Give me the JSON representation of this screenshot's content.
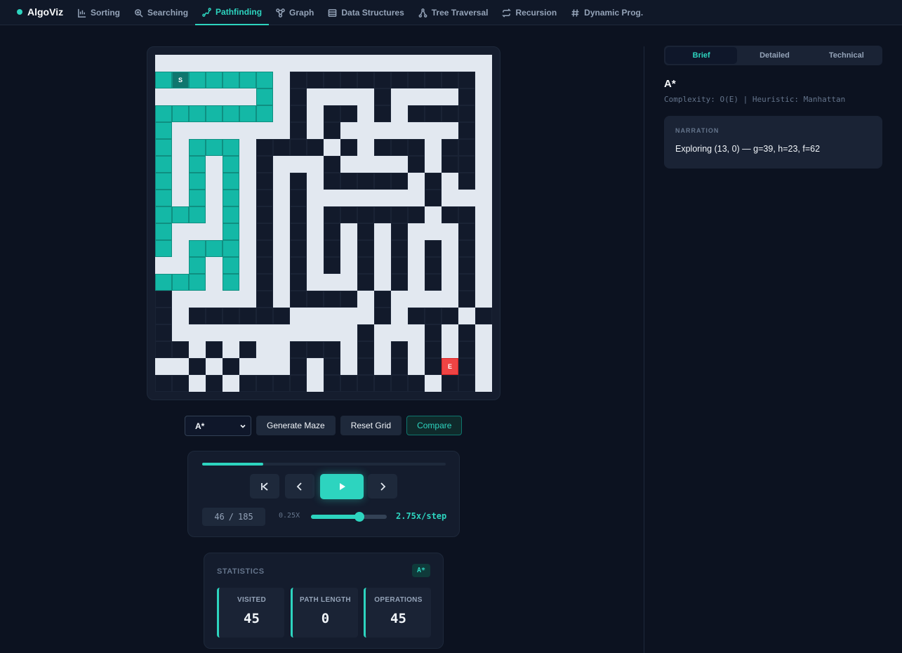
{
  "app": {
    "name": "AlgoViz"
  },
  "nav": [
    {
      "label": "Sorting",
      "icon": "sort-icon",
      "active": false
    },
    {
      "label": "Searching",
      "icon": "search-icon",
      "active": false
    },
    {
      "label": "Pathfinding",
      "icon": "route-icon",
      "active": true
    },
    {
      "label": "Graph",
      "icon": "graph-icon",
      "active": false
    },
    {
      "label": "Data Structures",
      "icon": "table-icon",
      "active": false
    },
    {
      "label": "Tree Traversal",
      "icon": "tree-icon",
      "active": false
    },
    {
      "label": "Recursion",
      "icon": "repeat-icon",
      "active": false
    },
    {
      "label": "Dynamic Prog.",
      "icon": "hash-icon",
      "active": false
    }
  ],
  "maze": {
    "legend": {
      "w": "wall",
      "o": "open",
      "v": "visited",
      "S": "start",
      "E": "end"
    },
    "rows": [
      "wwwwwwwwwwwwwwwwwwww",
      "vSvvvvvwooooooooooow",
      "wwwwwwvwowwwwowwwwow",
      "vvvvvvvwowoowowoooow",
      "vwwwwwwwowowwwwwwwow",
      "vwvvvwoooowowooowoow",
      "vwvwvwowwwowwwwowoow",
      "vwvwvwowowooooowowow",
      "vwvwvwowowwwwwwwowww",
      "vvvwvwowowoooooowoow",
      "vwwwvwowowowowowwwow",
      "vwvvvwowowowowowowow",
      "wwvwvwowowowowowowow",
      "vvvwvwowowwwowowowow",
      "owwwwwowoooowowwwwow",
      "owoooooowwwwwowooowow",
      "owwwwwwwwwwwowwwowow",
      "oowowowwooowowowowow",
      "wwowowwwowowowowoEow",
      "oowowoooowoooooowoow"
    ],
    "start_label": "S",
    "end_label": "E"
  },
  "controls": {
    "algorithm": "A*",
    "generate_label": "Generate Maze",
    "reset_label": "Reset Grid",
    "compare_label": "Compare"
  },
  "player": {
    "current_step": "46",
    "separator": "/",
    "total_steps": "185",
    "progress_fraction": 0.25,
    "speed_min": "0.25X",
    "speed_fraction": 0.64,
    "speed_value": "2.75x/step"
  },
  "stats": {
    "title": "STATISTICS",
    "badge": "A*",
    "items": [
      {
        "label": "VISITED",
        "value": "45"
      },
      {
        "label": "PATH LENGTH",
        "value": "0"
      },
      {
        "label": "OPERATIONS",
        "value": "45"
      }
    ]
  },
  "side": {
    "tabs": [
      "Brief",
      "Detailed",
      "Technical"
    ],
    "active_tab": 0,
    "algo_name": "A*",
    "meta": "Complexity: O(E) | Heuristic: Manhattan",
    "narration_label": "NARRATION",
    "narration": "Exploring (13, 0) — g=39, h=23, f=62"
  },
  "colors": {
    "accent": "#2dd4bf",
    "end": "#ef4444",
    "visited": "#14b8a6",
    "wall": "#e2e8f0"
  }
}
